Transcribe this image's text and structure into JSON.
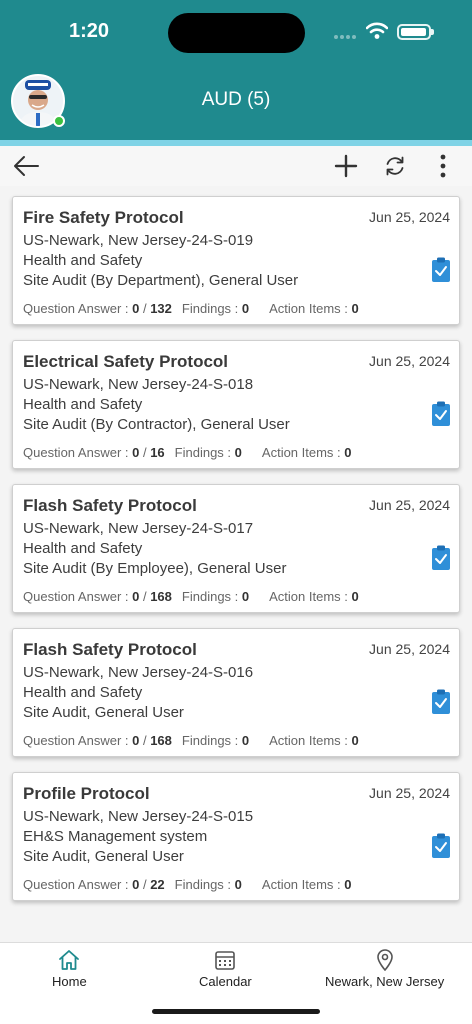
{
  "status_bar": {
    "time": "1:20"
  },
  "header": {
    "title": "AUD (5)",
    "avatar": "user-avatar"
  },
  "toolbar": {
    "back_icon": "arrow-left-icon",
    "add_icon": "plus-icon",
    "refresh_icon": "refresh-icon",
    "more_icon": "more-vertical-icon"
  },
  "audits": [
    {
      "title": "Fire Safety Protocol",
      "date": "Jun 25, 2024",
      "code": "US-Newark, New Jersey-24-S-019",
      "category": "Health and Safety",
      "type": "Site Audit (By Department), General User",
      "qa_label": "Question Answer :",
      "qa_answered": "0",
      "qa_total": "132",
      "findings_label": "Findings :",
      "findings": "0",
      "actions_label": "Action Items :",
      "actions": "0"
    },
    {
      "title": "Electrical Safety Protocol",
      "date": "Jun 25, 2024",
      "code": "US-Newark, New Jersey-24-S-018",
      "category": "Health and Safety",
      "type": "Site Audit (By Contractor), General User",
      "qa_label": "Question Answer :",
      "qa_answered": "0",
      "qa_total": "16",
      "findings_label": "Findings :",
      "findings": "0",
      "actions_label": "Action Items :",
      "actions": "0"
    },
    {
      "title": "Flash Safety Protocol",
      "date": "Jun 25, 2024",
      "code": "US-Newark, New Jersey-24-S-017",
      "category": "Health and Safety",
      "type": "Site Audit (By Employee), General User",
      "qa_label": "Question Answer :",
      "qa_answered": "0",
      "qa_total": "168",
      "findings_label": "Findings :",
      "findings": "0",
      "actions_label": "Action Items :",
      "actions": "0"
    },
    {
      "title": "Flash Safety Protocol",
      "date": "Jun 25, 2024",
      "code": "US-Newark, New Jersey-24-S-016",
      "category": "Health and Safety",
      "type": "Site Audit, General User",
      "qa_label": "Question Answer :",
      "qa_answered": "0",
      "qa_total": "168",
      "findings_label": "Findings :",
      "findings": "0",
      "actions_label": "Action Items :",
      "actions": "0"
    },
    {
      "title": "Profile Protocol",
      "date": "Jun 25, 2024",
      "code": "US-Newark, New Jersey-24-S-015",
      "category": "EH&S Management system",
      "type": "Site Audit, General User",
      "qa_label": "Question Answer :",
      "qa_answered": "0",
      "qa_total": "22",
      "findings_label": "Findings :",
      "findings": "0",
      "actions_label": "Action Items :",
      "actions": "0"
    }
  ],
  "bottom_nav": {
    "home": {
      "label": "Home",
      "icon": "home-icon"
    },
    "calendar": {
      "label": "Calendar",
      "icon": "calendar-icon"
    },
    "location": {
      "label": "Newark, New Jersey",
      "icon": "location-pin-icon"
    }
  },
  "colors": {
    "header": "#1f8a8e",
    "accent": "#7fd3e6",
    "check": "#2f8fd8",
    "online": "#3bc13f"
  }
}
